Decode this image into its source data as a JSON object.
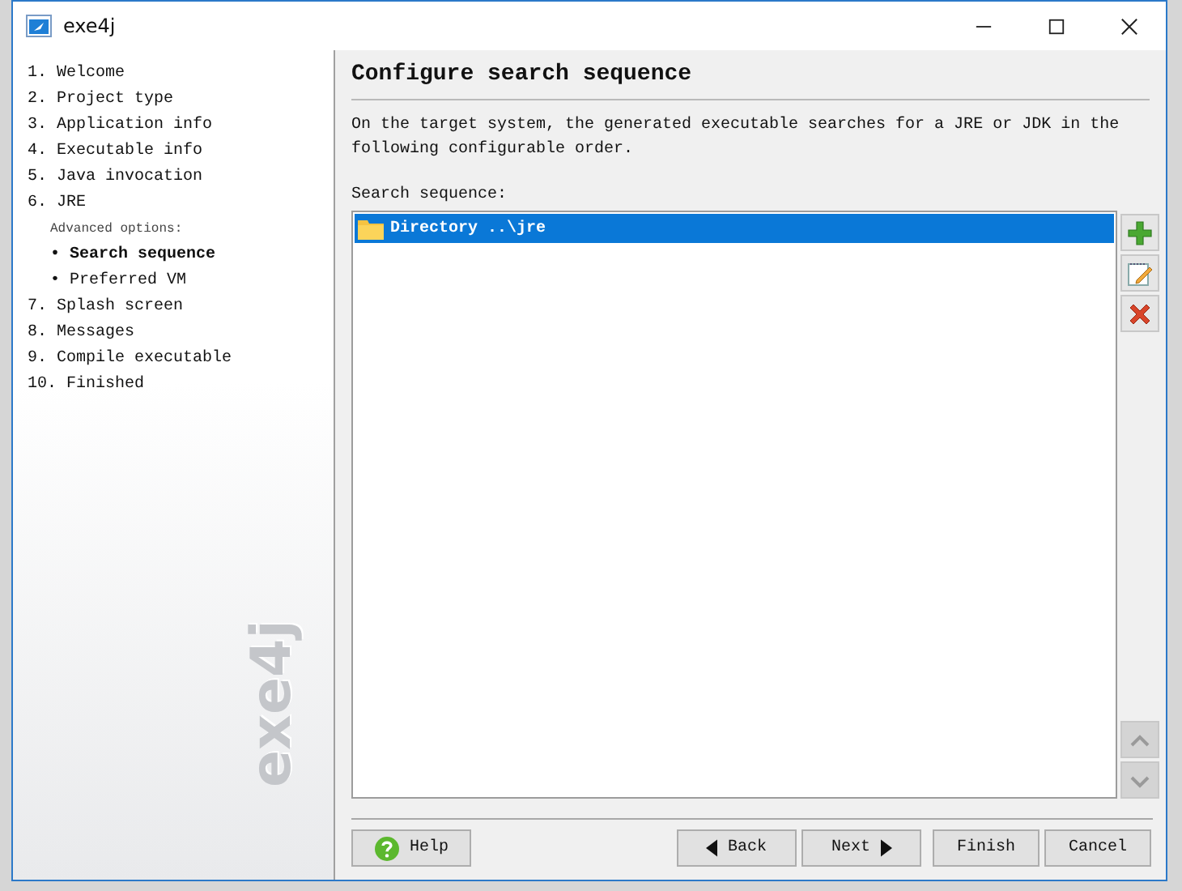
{
  "window": {
    "title": "exe4j"
  },
  "steps": [
    {
      "number": "1.",
      "label": "Welcome",
      "selected": false
    },
    {
      "number": "2.",
      "label": "Project type",
      "selected": false
    },
    {
      "number": "3.",
      "label": "Application info",
      "selected": false
    },
    {
      "number": "4.",
      "label": "Executable info",
      "selected": false
    },
    {
      "number": "5.",
      "label": "Java invocation",
      "selected": false
    },
    {
      "number": "6.",
      "label": "JRE",
      "selected": false,
      "advanced": {
        "label": "Advanced options:",
        "children": [
          {
            "bullet": "•",
            "label": "Search sequence",
            "selected": true
          },
          {
            "bullet": "•",
            "label": "Preferred VM",
            "selected": false
          }
        ]
      }
    },
    {
      "number": "7.",
      "label": "Splash screen",
      "selected": false
    },
    {
      "number": "8.",
      "label": "Messages",
      "selected": false
    },
    {
      "number": "9.",
      "label": "Compile executable",
      "selected": false
    },
    {
      "number": "10.",
      "label": "Finished",
      "selected": false
    }
  ],
  "sidebar_logo": "exe4j",
  "page": {
    "title": "Configure search sequence",
    "description": "On the target system, the generated executable searches for a JRE or JDK in the following configurable order.",
    "list_label": "Search sequence:"
  },
  "sequence": [
    {
      "kind": "directory",
      "prefix": "Directory ..",
      "bold_part": "\\jre",
      "selected": true
    }
  ],
  "side_buttons": [
    {
      "kind": "add",
      "disabled": false
    },
    {
      "kind": "edit",
      "disabled": false
    },
    {
      "kind": "remove",
      "disabled": false
    },
    {
      "kind": "up",
      "disabled": true
    },
    {
      "kind": "down",
      "disabled": true
    }
  ],
  "buttons": [
    {
      "kind": "help",
      "label": "Help"
    },
    {
      "kind": "back",
      "label": "Back"
    },
    {
      "kind": "next",
      "label": "Next"
    },
    {
      "kind": "plain",
      "label": "Finish"
    },
    {
      "kind": "plain",
      "label": "Cancel"
    }
  ]
}
